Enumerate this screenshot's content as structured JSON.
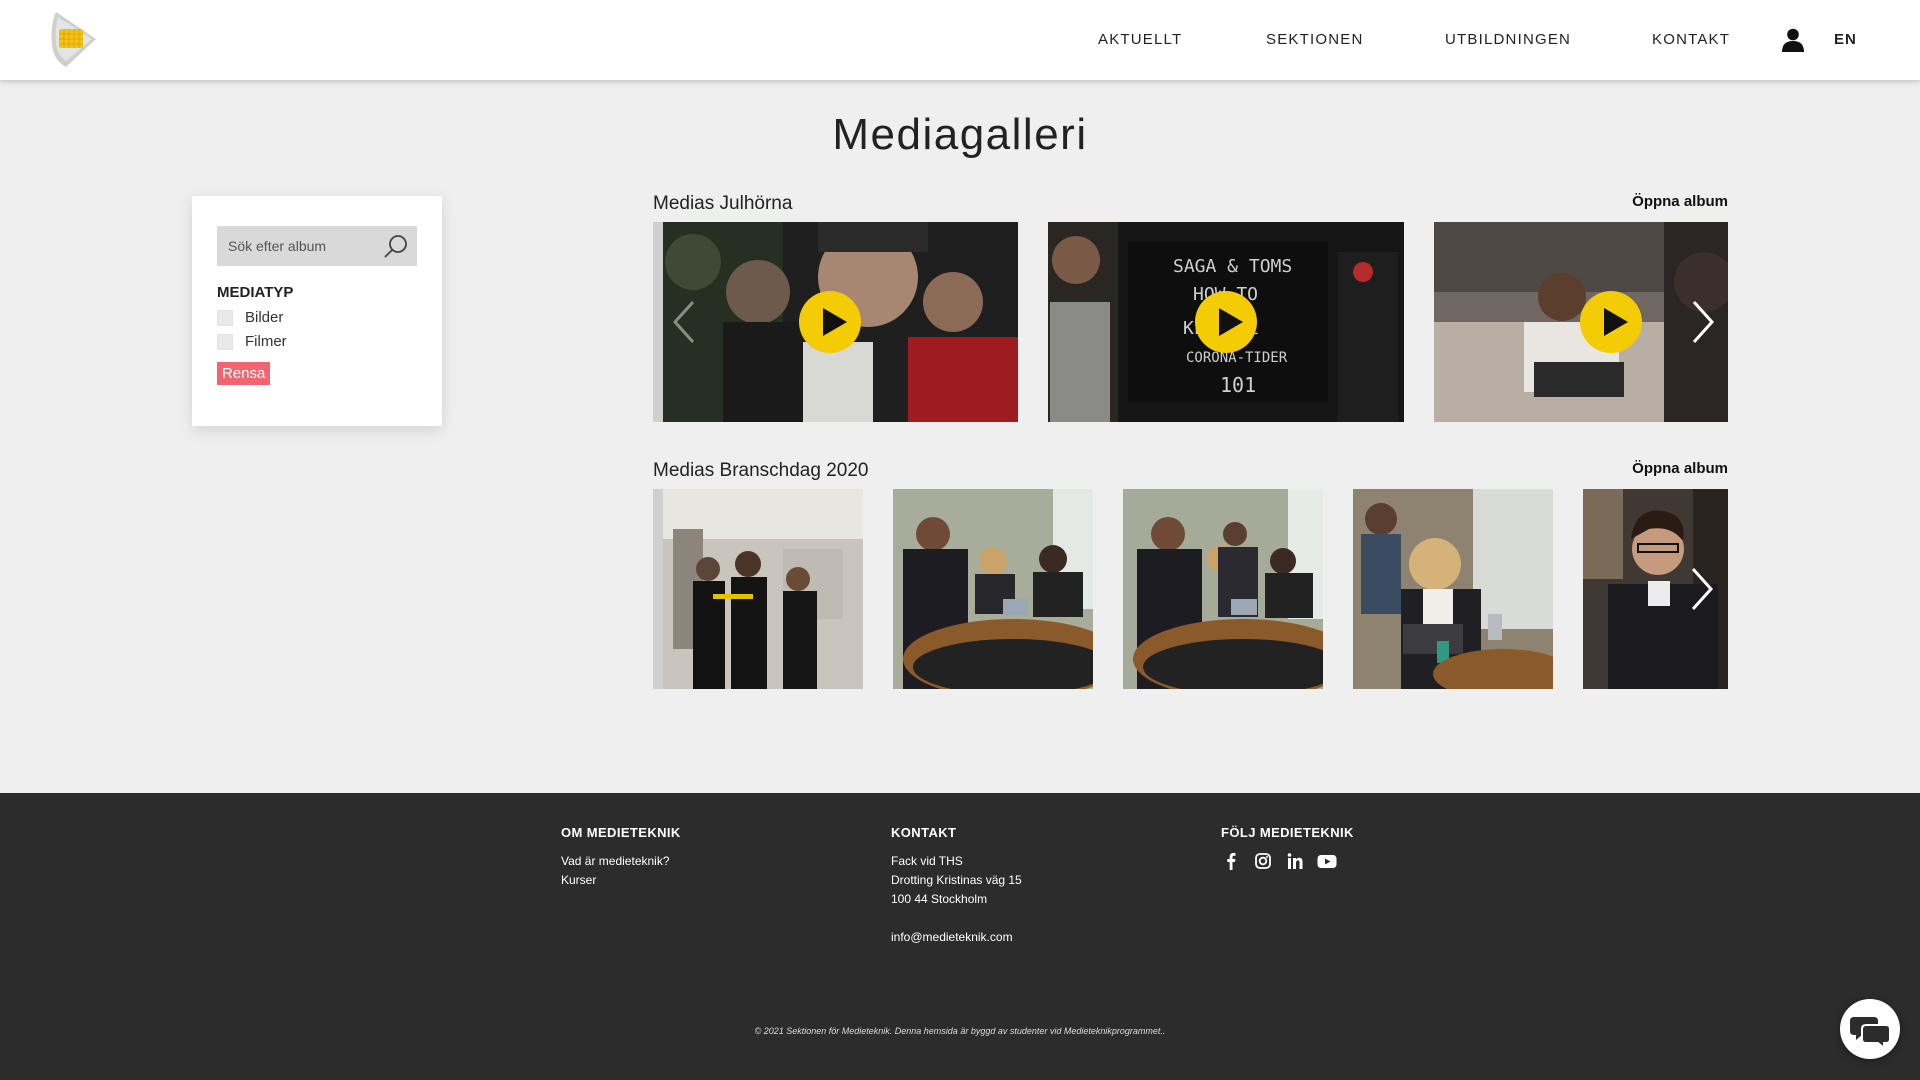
{
  "header": {
    "nav": [
      "AKTUELLT",
      "SEKTIONEN",
      "UTBILDNINGEN",
      "KONTAKT"
    ],
    "lang": "EN"
  },
  "page_title": "Mediagalleri",
  "filter": {
    "search_placeholder": "Sök efter album",
    "mediatype_heading": "MEDIATYP",
    "options": [
      "Bilder",
      "Filmer"
    ],
    "clear_label": "Rensa"
  },
  "albums": [
    {
      "title": "Medias Julhörna",
      "open_label": "Öppna album"
    },
    {
      "title": "Medias Branschdag 2020",
      "open_label": "Öppna album"
    }
  ],
  "footer": {
    "about": {
      "heading": "OM MEDIETEKNIK",
      "links": [
        "Vad är medieteknik?",
        "Kurser"
      ]
    },
    "contact": {
      "heading": "KONTAKT",
      "lines": [
        "Fack vid THS",
        "Drotting Kristinas väg 15",
        "100 44 Stockholm"
      ],
      "email": "info@medieteknik.com"
    },
    "follow": {
      "heading": "FÖLJ MEDIETEKNIK",
      "icons": [
        "facebook-icon",
        "instagram-icon",
        "linkedin-icon",
        "youtube-icon"
      ]
    },
    "copyright": "© 2021 Sektionen för Medieteknik. Denna hemsida är byggd av studenter vid Medieteknikprogrammet.."
  },
  "colors": {
    "accent_yellow": "#f3cc05",
    "clear_button": "#f0656f",
    "footer_bg": "#2c2c2c"
  }
}
